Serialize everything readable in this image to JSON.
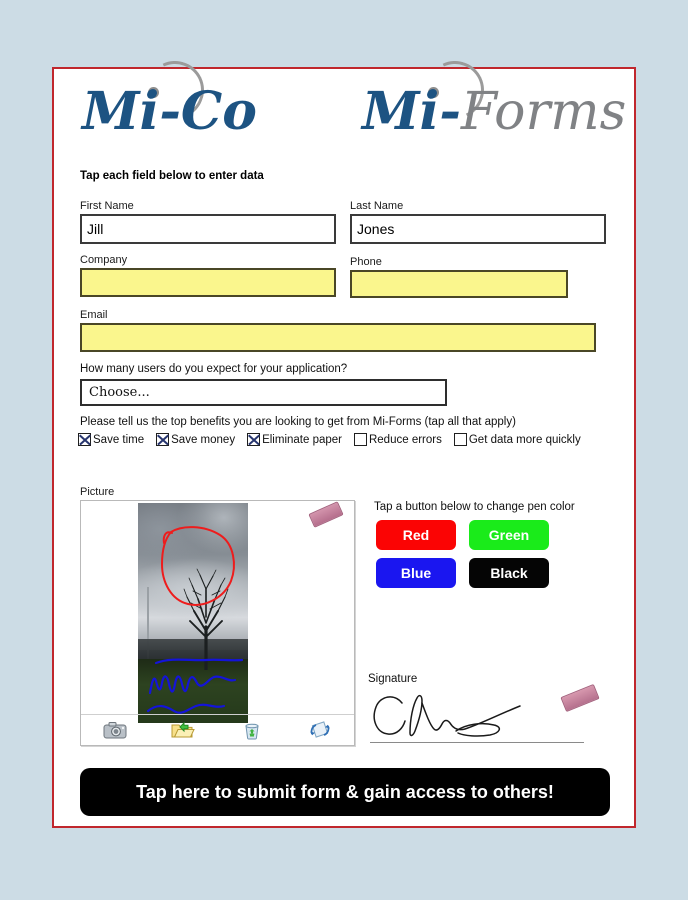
{
  "branding": {
    "logo_left_primary": "Mi-Co",
    "logo_right_primary": "Mi-",
    "logo_right_secondary": "Forms",
    "navy": "#1d5382",
    "gray": "#808285"
  },
  "instruction": "Tap each field below to enter data",
  "fields": {
    "first_name": {
      "label": "First Name",
      "value": "Jill",
      "placeholder": ""
    },
    "last_name": {
      "label": "Last Name",
      "value": "Jones",
      "placeholder": ""
    },
    "company": {
      "label": "Company",
      "value": "",
      "placeholder": ""
    },
    "phone": {
      "label": "Phone",
      "value": "",
      "placeholder": ""
    },
    "email": {
      "label": "Email",
      "value": "",
      "placeholder": ""
    }
  },
  "users_question": {
    "label": "How many users do you expect for your application?",
    "selected": "Choose..."
  },
  "benefits": {
    "prompt": "Please tell us the top benefits you are looking to get from Mi-Forms (tap all that apply)",
    "options": [
      {
        "label": "Save time",
        "checked": true
      },
      {
        "label": "Save money",
        "checked": true
      },
      {
        "label": "Eliminate paper",
        "checked": true
      },
      {
        "label": "Reduce errors",
        "checked": false
      },
      {
        "label": "Get data more quickly",
        "checked": false
      }
    ]
  },
  "picture": {
    "label": "Picture",
    "toolbar": [
      {
        "name": "camera-icon"
      },
      {
        "name": "open-folder-icon"
      },
      {
        "name": "recycle-bin-icon"
      },
      {
        "name": "rotate-icon"
      }
    ],
    "eraser": "eraser-icon"
  },
  "pen": {
    "hint": "Tap a button below to change pen color",
    "buttons": [
      {
        "label": "Red",
        "color": "#fb0404"
      },
      {
        "label": "Green",
        "color": "#1aeb1a"
      },
      {
        "label": "Blue",
        "color": "#1a16f0"
      },
      {
        "label": "Black",
        "color": "#050505"
      }
    ]
  },
  "signature": {
    "label": "Signature",
    "eraser": "eraser-icon"
  },
  "submit": {
    "label": "Tap here to submit form & gain access to others!"
  }
}
